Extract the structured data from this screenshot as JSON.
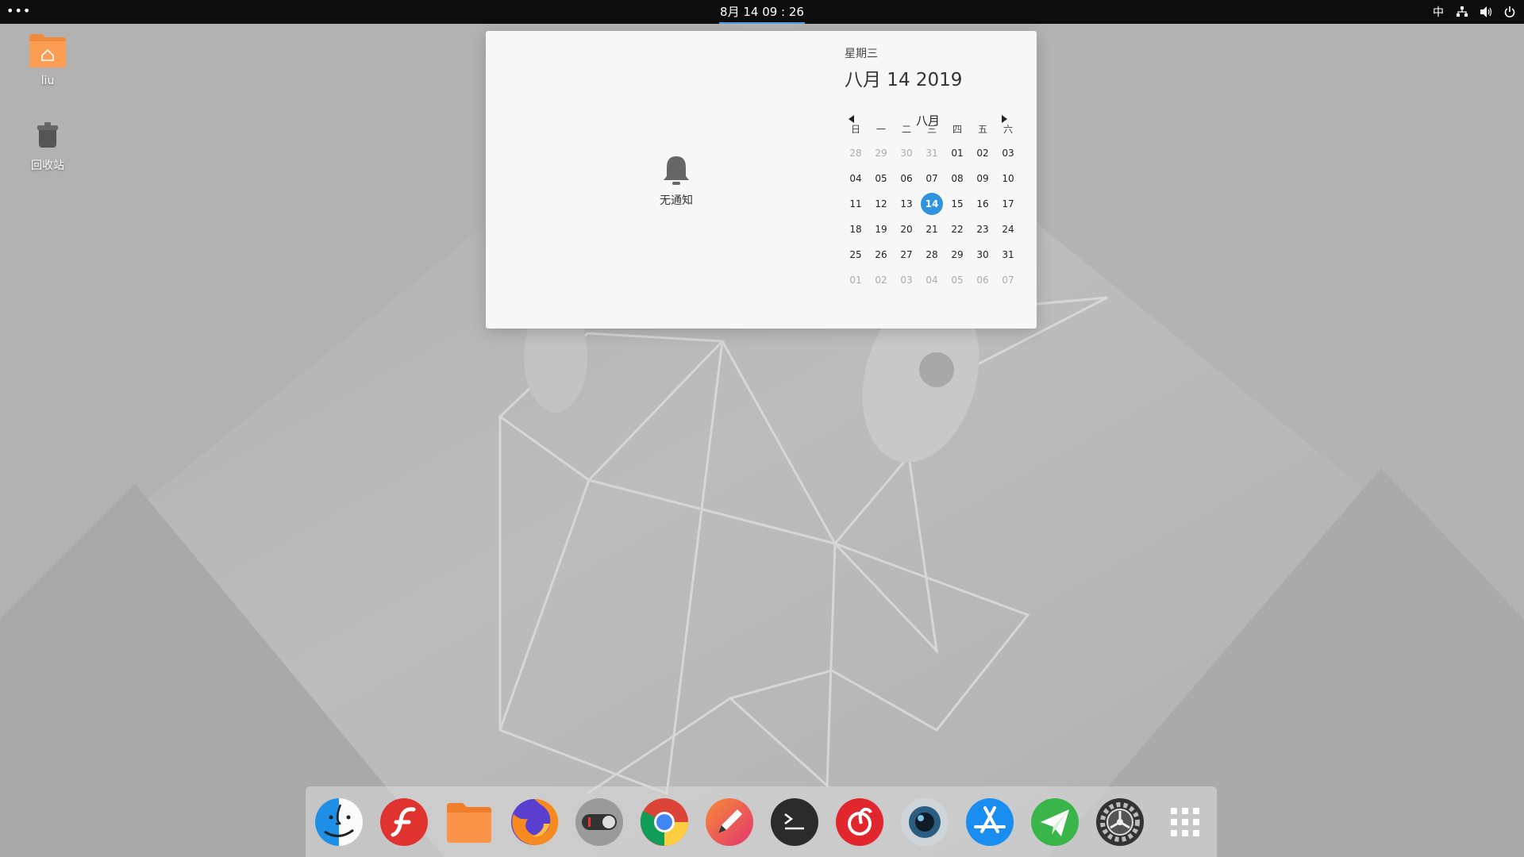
{
  "topbar": {
    "menu_icon": "more-dots-icon",
    "clock": "8月 14  09 : 26",
    "tray": {
      "input_method": "中",
      "network_icon": "network-icon",
      "volume_icon": "volume-icon",
      "power_icon": "power-icon"
    }
  },
  "desktop": {
    "icons": [
      {
        "label": "liu",
        "icon": "home-folder-icon"
      },
      {
        "label": "回收站",
        "icon": "trash-icon"
      }
    ]
  },
  "notifications": {
    "empty_text": "无通知",
    "icon": "bell-icon"
  },
  "calendar": {
    "weekday": "星期三",
    "date_display": "八月 14 2019",
    "month": "八月",
    "prev_icon": "triangle-left-icon",
    "next_icon": "triangle-right-icon",
    "weekday_headers": [
      "日",
      "一",
      "二",
      "三",
      "四",
      "五",
      "六"
    ],
    "weeks": [
      [
        "28",
        "29",
        "30",
        "31",
        "01",
        "02",
        "03"
      ],
      [
        "04",
        "05",
        "06",
        "07",
        "08",
        "09",
        "10"
      ],
      [
        "11",
        "12",
        "13",
        "14",
        "15",
        "16",
        "17"
      ],
      [
        "18",
        "19",
        "20",
        "21",
        "22",
        "23",
        "24"
      ],
      [
        "25",
        "26",
        "27",
        "28",
        "29",
        "30",
        "31"
      ],
      [
        "01",
        "02",
        "03",
        "04",
        "05",
        "06",
        "07"
      ]
    ],
    "selected_day": "14",
    "accent_color": "#2f93e0"
  },
  "dock": {
    "items": [
      {
        "name": "finder-icon",
        "active": true
      },
      {
        "name": "flash-player-icon"
      },
      {
        "name": "folder-icon"
      },
      {
        "name": "firefox-icon"
      },
      {
        "name": "toggle-switch-icon"
      },
      {
        "name": "chrome-icon"
      },
      {
        "name": "pencil-editor-icon"
      },
      {
        "name": "terminal-icon"
      },
      {
        "name": "netease-music-icon"
      },
      {
        "name": "camera-icon"
      },
      {
        "name": "app-store-icon"
      },
      {
        "name": "paper-plane-icon"
      },
      {
        "name": "system-settings-icon"
      },
      {
        "name": "app-launcher-grid-icon"
      }
    ]
  }
}
